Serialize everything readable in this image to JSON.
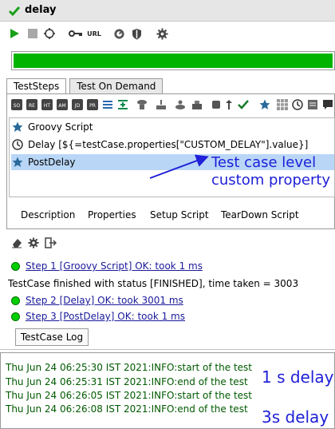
{
  "window": {
    "title": "delay"
  },
  "toolbar": {
    "url_label": "URL"
  },
  "progress": {
    "fraction": 1.0,
    "color": "#00b400"
  },
  "tabs": [
    {
      "label": "TestSteps",
      "active": true
    },
    {
      "label": "Test On Demand",
      "active": false
    }
  ],
  "steps": [
    {
      "icon": "star-icon",
      "label": "Groovy Script",
      "selected": false
    },
    {
      "icon": "clock-icon",
      "label": "Delay [${=testCase.properties[\"CUSTOM_DELAY\"].value}]",
      "selected": false
    },
    {
      "icon": "star-icon",
      "label": "PostDelay",
      "selected": true
    }
  ],
  "annotation_top": {
    "line1": "Test case level",
    "line2": "custom property"
  },
  "subtabs": [
    "Description",
    "Properties",
    "Setup Script",
    "TearDown Script"
  ],
  "log": {
    "step1": "Step 1 [Groovy Script] OK: took 1 ms",
    "finished": "TestCase finished with status [FINISHED], time taken = 3003",
    "step2": "Step 2 [Delay] OK: took 3001 ms",
    "step3": "Step 3 [PostDelay] OK: took 1 ms",
    "button": "TestCase Log"
  },
  "console": {
    "lines": [
      "Thu Jun 24 06:25:30 IST 2021:INFO:start of the test",
      "Thu Jun 24 06:25:31 IST 2021:INFO:end of the test",
      "Thu Jun 24 06:26:05 IST 2021:INFO:start of the test",
      "Thu Jun 24 06:26:08 IST 2021:INFO:end of the test"
    ],
    "annotation_1s": "1 s delay",
    "annotation_3s": "3s delay"
  },
  "colors": {
    "accent": "#2020d8",
    "ok_green": "#00d000",
    "console_text": "#005a00",
    "selection": "#b9d6f6"
  }
}
